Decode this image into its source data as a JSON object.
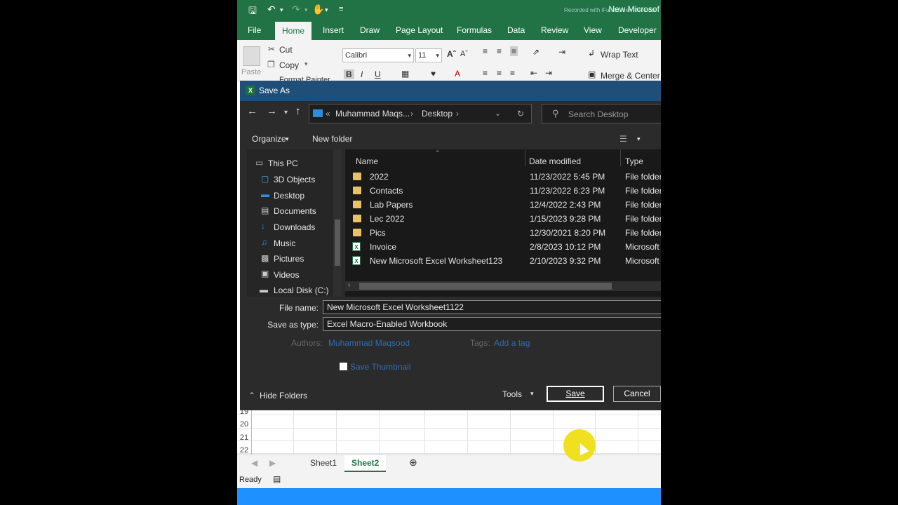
{
  "excel": {
    "title": "New Microsof",
    "recorded_note": "Recorded with iFun Screen Recorder",
    "tabs": [
      "File",
      "Home",
      "Insert",
      "Draw",
      "Page Layout",
      "Formulas",
      "Data",
      "Review",
      "View",
      "Developer"
    ],
    "active_tab": "Home",
    "clipboard": {
      "paste": "Paste",
      "cut": "Cut",
      "copy": "Copy",
      "format_painter": "Format Painter"
    },
    "font": {
      "name": "Calibri",
      "size": "11"
    },
    "alignment": {
      "wrap_text": "Wrap Text",
      "merge_center": "Merge & Center"
    },
    "rows": [
      "19",
      "20",
      "21",
      "22"
    ],
    "sheets": [
      "Sheet1",
      "Sheet2"
    ],
    "active_sheet": "Sheet2",
    "status": "Ready"
  },
  "dialog": {
    "title": "Save As",
    "breadcrumb": [
      "Muhammad Maqs...",
      "Desktop"
    ],
    "search_placeholder": "Search Desktop",
    "organize": "Organize",
    "new_folder": "New folder",
    "nav_items": [
      "This PC",
      "3D Objects",
      "Desktop",
      "Documents",
      "Downloads",
      "Music",
      "Pictures",
      "Videos",
      "Local Disk (C:)"
    ],
    "columns": {
      "name": "Name",
      "date": "Date modified",
      "type": "Type"
    },
    "files": [
      {
        "name": "2022",
        "date": "11/23/2022 5:45 PM",
        "type": "File folder",
        "kind": "folder"
      },
      {
        "name": "Contacts",
        "date": "11/23/2022 6:23 PM",
        "type": "File folder",
        "kind": "folder"
      },
      {
        "name": "Lab Papers",
        "date": "12/4/2022 2:43 PM",
        "type": "File folder",
        "kind": "folder"
      },
      {
        "name": "Lec 2022",
        "date": "1/15/2023 9:28 PM",
        "type": "File folder",
        "kind": "folder"
      },
      {
        "name": "Pics",
        "date": "12/30/2021 8:20 PM",
        "type": "File folder",
        "kind": "folder"
      },
      {
        "name": "Invoice",
        "date": "2/8/2023 10:12 PM",
        "type": "Microsoft",
        "kind": "excel"
      },
      {
        "name": "New Microsoft Excel Worksheet123",
        "date": "2/10/2023 9:32 PM",
        "type": "Microsoft",
        "kind": "excel"
      }
    ],
    "file_name_label": "File name:",
    "file_name_value": "New Microsoft Excel Worksheet1122",
    "save_type_label": "Save as type:",
    "save_type_value": "Excel Macro-Enabled Workbook",
    "authors_label": "Authors:",
    "authors_value": "Muhammad Maqsood",
    "tags_label": "Tags:",
    "tags_value": "Add a tag",
    "save_thumbnail": "Save Thumbnail",
    "hide_folders": "Hide Folders",
    "tools": "Tools",
    "save": "Save",
    "cancel": "Cancel"
  },
  "colors": {
    "excel_green": "#217346",
    "dialog_bg": "#2b2b2b",
    "title_bar": "#1f4e79",
    "link": "#3b7fd4",
    "highlight": "#f0e020"
  }
}
